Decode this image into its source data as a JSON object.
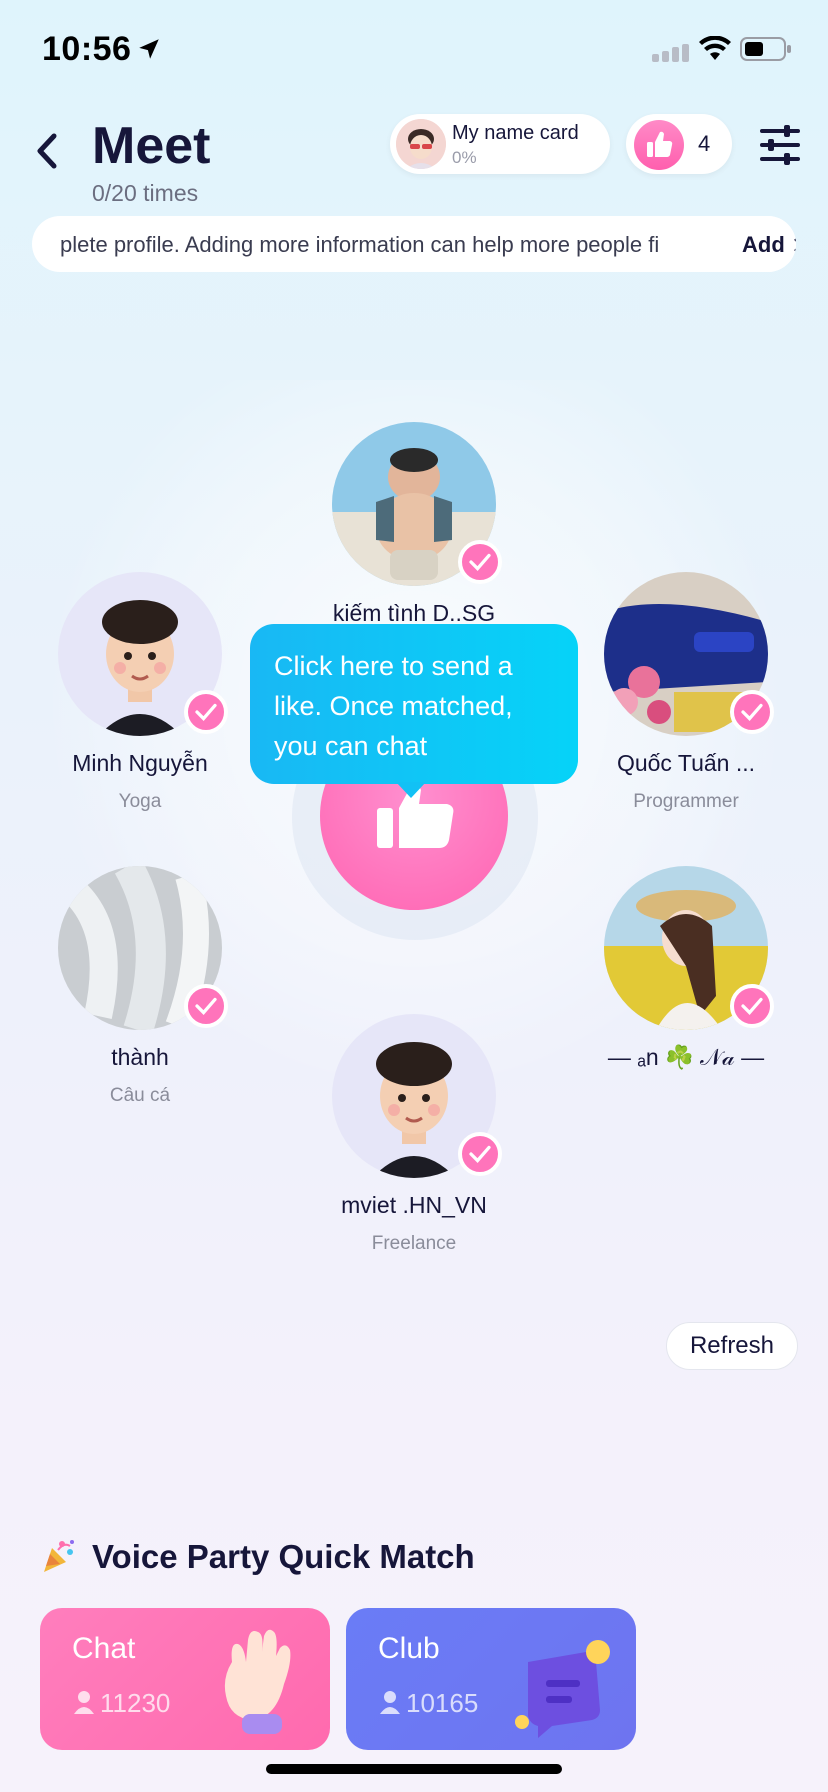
{
  "status_bar": {
    "time": "10:56"
  },
  "header": {
    "title": "Meet",
    "subtitle": "0/20 times",
    "name_card": {
      "title": "My name card",
      "percent": "0%"
    },
    "likes_count": "4"
  },
  "banner": {
    "text": "plete profile. Adding more information can help more people fi",
    "add_label": "Add"
  },
  "users": [
    {
      "name": "kiếm tình D..SG",
      "sub": ""
    },
    {
      "name": "Minh Nguyễn",
      "sub": "Yoga"
    },
    {
      "name": "Quốc Tuấn ...",
      "sub": "Programmer"
    },
    {
      "name": "thành",
      "sub": "Câu cá"
    },
    {
      "name": "— ₐn ☘️ 𝒩𝒶 —",
      "sub": ""
    },
    {
      "name": "mviet .HN_VN",
      "sub": "Freelance"
    }
  ],
  "tooltip": {
    "text": "Click here to send a like. Once matched, you can chat"
  },
  "refresh_label": "Refresh",
  "voice_party": {
    "title": "Voice Party Quick Match",
    "cards": [
      {
        "label": "Chat",
        "count": "11230"
      },
      {
        "label": "Club",
        "count": "10165"
      }
    ]
  },
  "colors": {
    "accent_pink": "#ff6cb4",
    "tooltip_blue": "#19b8f4",
    "club_purple": "#6a7cf6"
  }
}
